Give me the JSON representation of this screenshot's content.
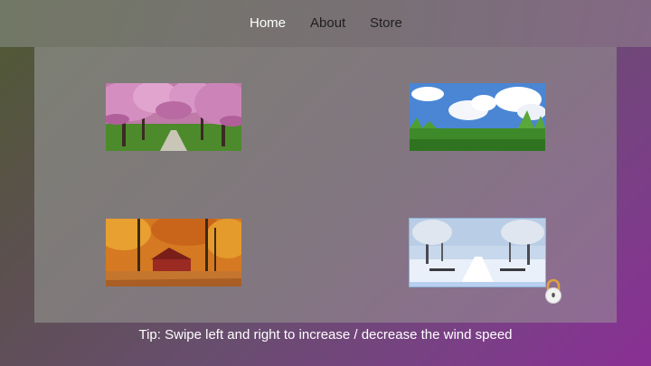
{
  "nav": {
    "items": [
      {
        "label": "Home",
        "active": true
      },
      {
        "label": "About",
        "active": false
      },
      {
        "label": "Store",
        "active": false
      }
    ]
  },
  "scenes": [
    {
      "name": "spring",
      "locked": false
    },
    {
      "name": "summer",
      "locked": false
    },
    {
      "name": "autumn",
      "locked": false
    },
    {
      "name": "winter",
      "locked": true
    }
  ],
  "tip": "Tip: Swipe left and right to increase / decrease the wind speed",
  "colors": {
    "nav_active": "#ffffff",
    "nav_inactive": "#1f1f1f",
    "lock_shackle": "#e0a040",
    "lock_body": "#f2f2f2"
  }
}
